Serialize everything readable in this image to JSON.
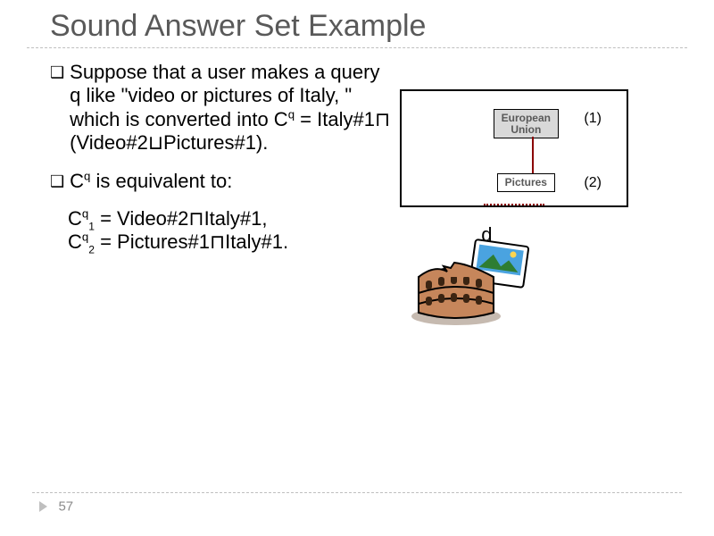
{
  "title": "Sound Answer Set Example",
  "bullets": {
    "b1_prefix": "Suppose that a user makes a query q like \"video or pictures of Italy, \" which is converted into C",
    "b1_sup": "q",
    "b1_mid": " = Italy#1",
    "b1_op1": "⊓",
    "b1_paren_open": " (Video#2",
    "b1_op2": "⊔",
    "b1_paren_close": "Pictures#1).",
    "b2_prefix": "C",
    "b2_sup": "q",
    "b2_suffix": " is equivalent to:",
    "eq1_lhs": "C",
    "eq1_sup": "q",
    "eq1_sub": "1",
    "eq1_mid": " = Video#2",
    "eq1_op": "⊓",
    "eq1_rhs": "Italy#1,",
    "eq2_lhs": "C",
    "eq2_sup": "q",
    "eq2_sub": "2",
    "eq2_mid": " = Pictures#1",
    "eq2_op": "⊓",
    "eq2_rhs": "Italy#1."
  },
  "context": {
    "chip1_line1": "European",
    "chip1_line2": "Union",
    "chip2": "Pictures",
    "label1": "(1)",
    "label2": "(2)",
    "doc_label": "d"
  },
  "page_number": "57"
}
